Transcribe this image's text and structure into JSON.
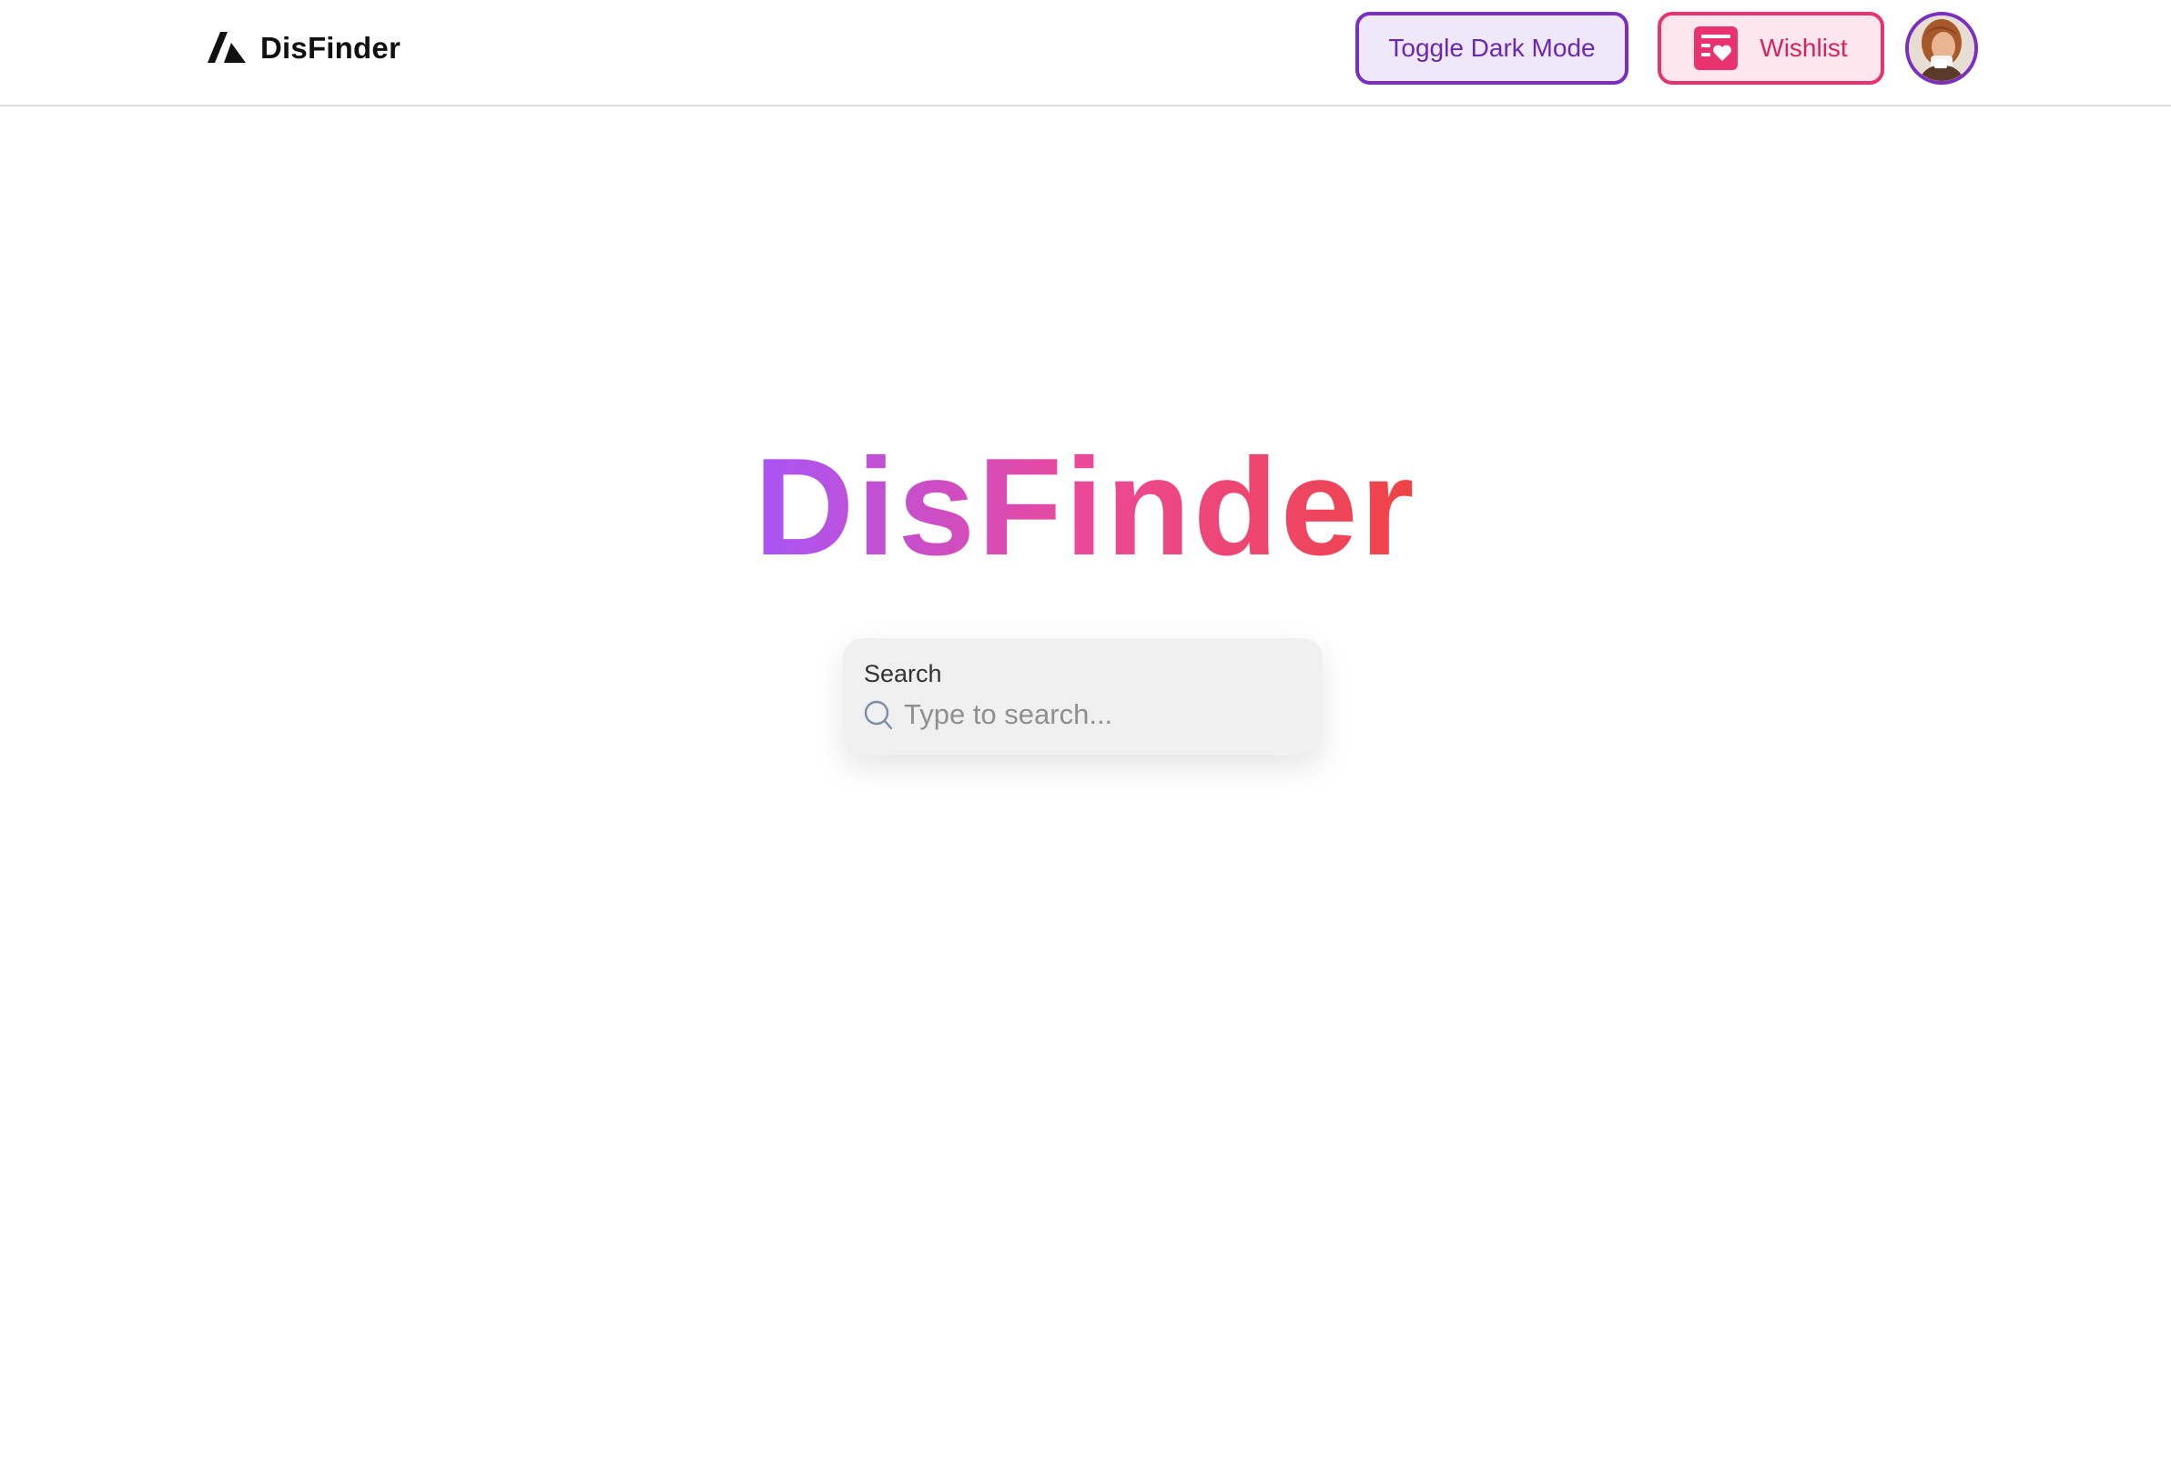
{
  "nav": {
    "brand_name": "DisFinder",
    "toggle_dark_label": "Toggle Dark Mode",
    "wishlist_label": "Wishlist"
  },
  "hero": {
    "title": "DisFinder"
  },
  "search": {
    "label": "Search",
    "placeholder": "Type to search...",
    "value": ""
  },
  "icons": {
    "brand": "triangle-logo-icon",
    "wishlist": "list-heart-icon",
    "search": "search-icon",
    "avatar": "user-avatar"
  },
  "colors": {
    "primary_purple": "#7b2fc0",
    "primary_pink": "#e8336f",
    "gradient_start": "#a855f7",
    "gradient_mid": "#ec4899",
    "gradient_end": "#ef4444"
  }
}
